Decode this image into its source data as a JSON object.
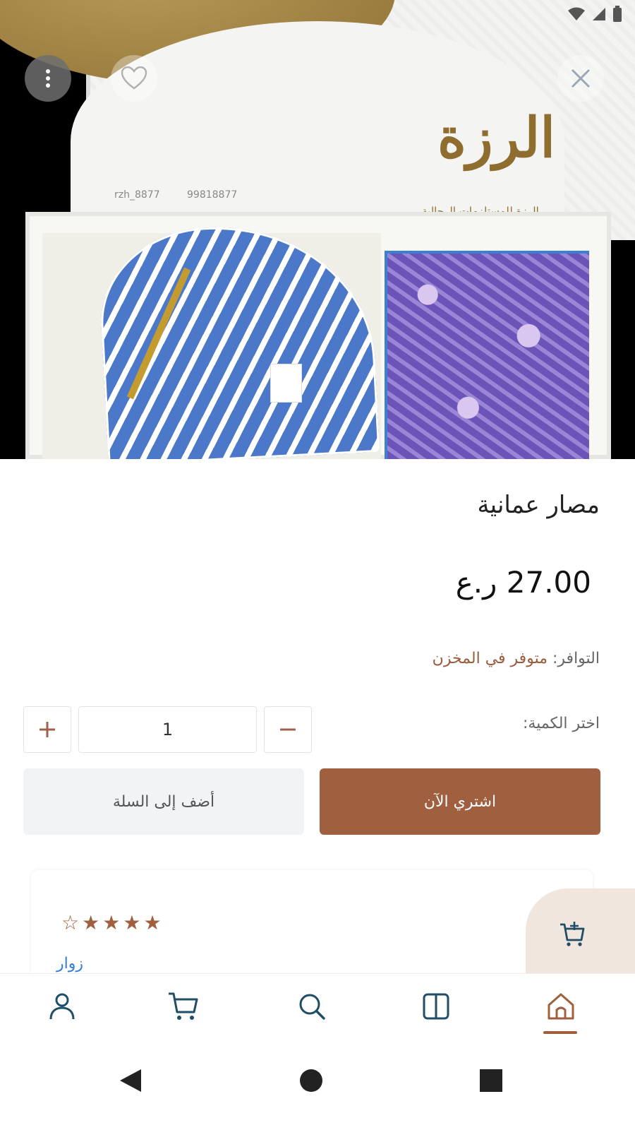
{
  "hero": {
    "logo_text": "الرزة",
    "logo_subtitle": "الرزة للمستلزمات الرجالية",
    "instagram": "rzh_8877",
    "phone": "99818877"
  },
  "product": {
    "title": "مصار عمانية",
    "price": "27.00 ر.ع",
    "availability_label": "التوافر:",
    "availability_value": "متوفر في المخزن",
    "quantity_label": "اختر الكمية:",
    "quantity_value": "1",
    "add_to_cart_label": "أضف إلى السلة",
    "buy_now_label": "اشتري الآن"
  },
  "review": {
    "rating": 4,
    "max_rating": 5,
    "reviewer": "زوار"
  },
  "icons": {
    "menu": "more-vertical-icon",
    "favorite": "heart-icon",
    "close": "close-icon",
    "cart_fab": "add-to-cart-icon"
  },
  "bottom_nav": {
    "items": [
      "profile",
      "cart",
      "search",
      "categories",
      "home"
    ],
    "active": "home"
  },
  "colors": {
    "accent": "#a0603f",
    "link": "#2f7ddc",
    "nav_icon": "#1f4e66"
  }
}
